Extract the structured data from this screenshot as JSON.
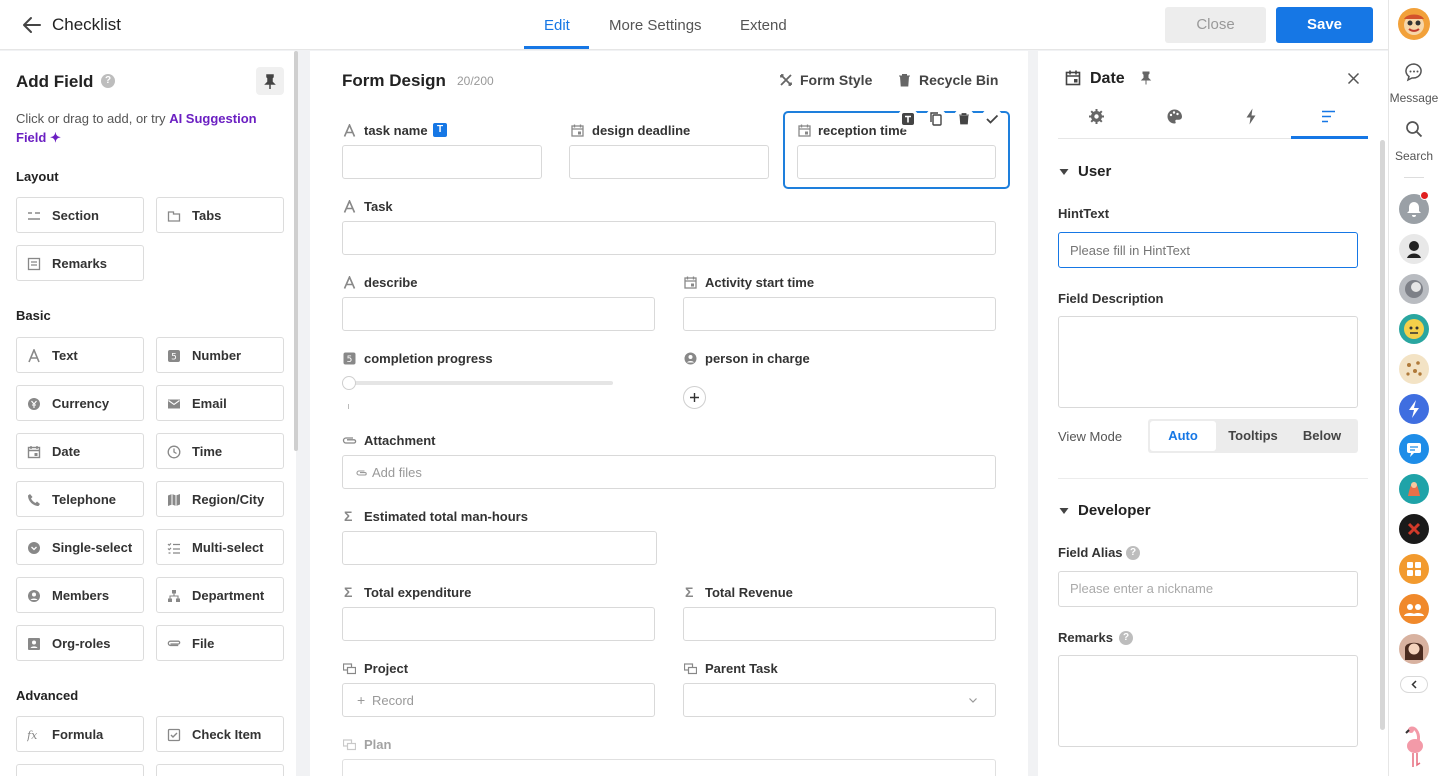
{
  "header": {
    "title": "Checklist",
    "tabs": [
      "Edit",
      "More Settings",
      "Extend"
    ],
    "close_label": "Close",
    "save_label": "Save"
  },
  "left_panel": {
    "title": "Add Field",
    "hint_prefix": "Click or drag to add, or try",
    "hint_ai": "AI Suggestion Field",
    "sections": {
      "layout": "Layout",
      "basic": "Basic",
      "advanced": "Advanced"
    },
    "layout_items": [
      {
        "label": "Section",
        "icon": "section-icon"
      },
      {
        "label": "Tabs",
        "icon": "tabs-icon"
      },
      {
        "label": "Remarks",
        "icon": "remarks-icon"
      }
    ],
    "basic_items": [
      {
        "label": "Text",
        "icon": "text-icon"
      },
      {
        "label": "Number",
        "icon": "number-icon"
      },
      {
        "label": "Currency",
        "icon": "currency-icon"
      },
      {
        "label": "Email",
        "icon": "email-icon"
      },
      {
        "label": "Date",
        "icon": "calendar-icon"
      },
      {
        "label": "Time",
        "icon": "clock-icon"
      },
      {
        "label": "Telephone",
        "icon": "phone-icon"
      },
      {
        "label": "Region/City",
        "icon": "map-icon"
      },
      {
        "label": "Single-select",
        "icon": "single-select-icon"
      },
      {
        "label": "Multi-select",
        "icon": "multi-select-icon"
      },
      {
        "label": "Members",
        "icon": "member-icon"
      },
      {
        "label": "Department",
        "icon": "department-icon"
      },
      {
        "label": "Org-roles",
        "icon": "org-role-icon"
      },
      {
        "label": "File",
        "icon": "paperclip-icon"
      }
    ],
    "advanced_items": [
      {
        "label": "Formula",
        "icon": "formula-icon"
      },
      {
        "label": "Check Item",
        "icon": "checkbox-icon"
      }
    ]
  },
  "form": {
    "title": "Form Design",
    "count": "20/200",
    "style_label": "Form Style",
    "recycle_label": "Recycle Bin",
    "fields": {
      "task_name": "task name",
      "task_name_badge": "T",
      "design_deadline": "design deadline",
      "reception_time": "reception time",
      "task": "Task",
      "describe": "describe",
      "activity_start": "Activity start time",
      "completion": "completion progress",
      "person": "person in charge",
      "attachment": "Attachment",
      "add_files": "Add files",
      "man_hours": "Estimated total man-hours",
      "expenditure": "Total expenditure",
      "revenue": "Total Revenue",
      "project": "Project",
      "record": "Record",
      "parent_task": "Parent Task",
      "plan": "Plan"
    },
    "progress_value": 0
  },
  "properties": {
    "title": "Date",
    "tab_icons": [
      "gear-icon",
      "palette-icon",
      "lightning-icon",
      "list-icon"
    ],
    "user_section": "User",
    "hint_label": "HintText",
    "hint_placeholder": "Please fill in HintText",
    "desc_label": "Field Description",
    "view_mode_label": "View Mode",
    "view_modes": [
      "Auto",
      "Tooltips",
      "Below"
    ],
    "view_mode_selected": "Auto",
    "developer_section": "Developer",
    "alias_label": "Field Alias",
    "alias_placeholder": "Please enter a nickname",
    "remarks_label": "Remarks"
  },
  "sidebar": {
    "message_label": "Message",
    "search_label": "Search"
  },
  "colors": {
    "accent": "#1677e5",
    "ai_purple": "#6b1fc2"
  }
}
